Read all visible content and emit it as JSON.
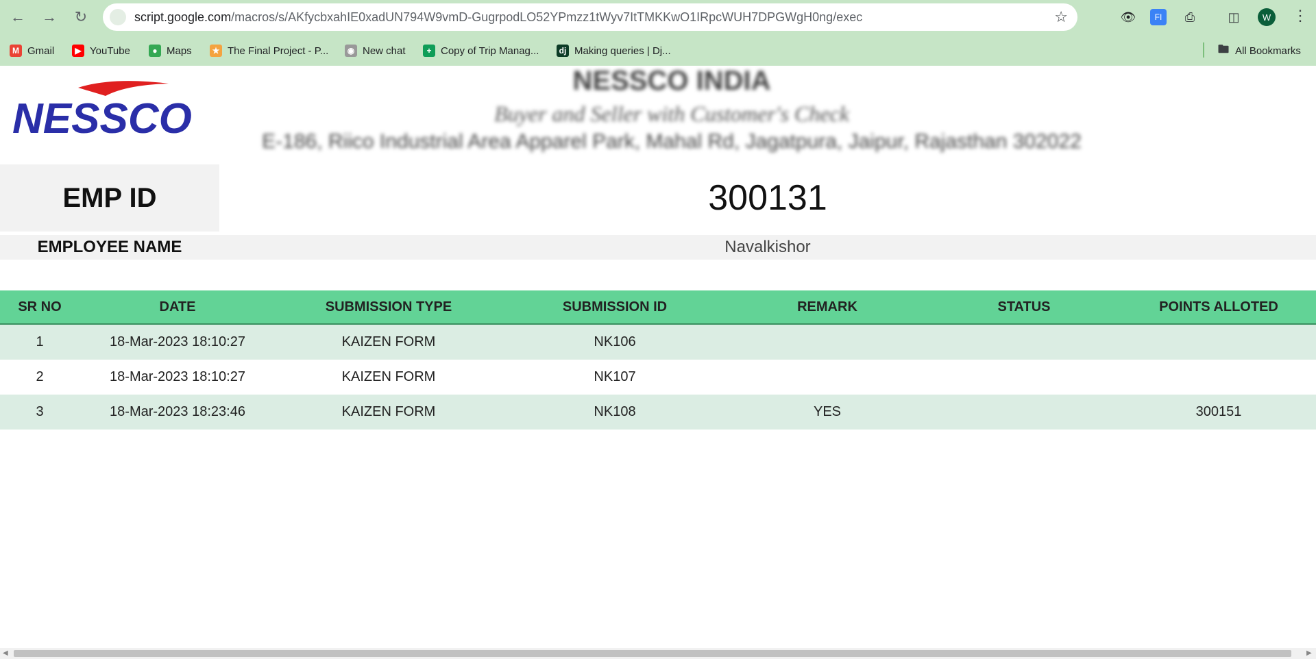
{
  "browser": {
    "url_host": "script.google.com",
    "url_path": "/macros/s/AKfycbxahIE0xadUN794W9vmD-GugrpodLO52YPmzz1tWyv7ItTMKKwO1IRpcWUH7DPGWgH0ng/exec",
    "profile_initial": "W",
    "bookmarks": [
      {
        "label": "Gmail"
      },
      {
        "label": "YouTube"
      },
      {
        "label": "Maps"
      },
      {
        "label": "The Final Project - P..."
      },
      {
        "label": "New chat"
      },
      {
        "label": "Copy of Trip Manag..."
      },
      {
        "label": "Making queries | Dj..."
      }
    ],
    "all_bookmarks": "All Bookmarks"
  },
  "header": {
    "company": "NESSCO INDIA",
    "tagline": "Buyer and Seller with Customer's Check",
    "address": "E-186, Riico Industrial Area Apparel Park, Mahal Rd, Jagatpura, Jaipur, Rajasthan 302022",
    "logo_text": "NESSCO"
  },
  "employee": {
    "id_label": "EMP ID",
    "id_value": "300131",
    "name_label": "EMPLOYEE NAME",
    "name_value": "Navalkishor"
  },
  "table": {
    "columns": [
      "SR NO",
      "DATE",
      "SUBMISSION TYPE",
      "SUBMISSION ID",
      "REMARK",
      "STATUS",
      "POINTS ALLOTED"
    ],
    "rows": [
      [
        "1",
        "18-Mar-2023 18:10:27",
        "KAIZEN FORM",
        "NK106",
        "",
        "",
        ""
      ],
      [
        "2",
        "18-Mar-2023 18:10:27",
        "KAIZEN FORM",
        "NK107",
        "",
        "",
        ""
      ],
      [
        "3",
        "18-Mar-2023 18:23:46",
        "KAIZEN FORM",
        "NK108",
        "YES",
        "",
        "300151"
      ]
    ]
  }
}
